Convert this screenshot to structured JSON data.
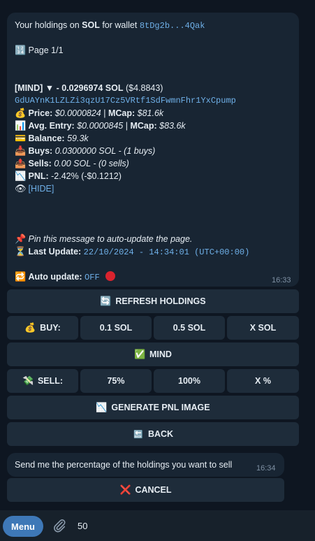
{
  "message": {
    "intro_prefix": "Your holdings on ",
    "intro_chain": "SOL",
    "intro_mid": " for wallet ",
    "intro_wallet": "8tDg2b...4Qak",
    "page_icon": "🔢",
    "page_label": "Page 1/1",
    "token_header_name": "[MIND] ▼ - 0.0296974 SOL",
    "token_header_usd": " ($4.8843)",
    "token_address": "GdUAYnK1LZLZi3qzU17Cz5VRtf1SdFwmnFhr1YxCpump",
    "price": {
      "icon": "💰",
      "label": "Price:",
      "value": "$0.0000824",
      "sep": " | ",
      "mcap_label": "MCap:",
      "mcap_value": "$81.6k"
    },
    "avg_entry": {
      "icon": "📊",
      "label": "Avg. Entry:",
      "value": "$0.0000845",
      "sep": " | ",
      "mcap_label": "MCap:",
      "mcap_value": "$83.6k"
    },
    "balance": {
      "icon": "💳",
      "label": "Balance:",
      "value": "59.3k"
    },
    "buys": {
      "icon": "📥",
      "label": "Buys:",
      "value": "0.0300000 SOL - (1 buys)"
    },
    "sells": {
      "icon": "📤",
      "label": "Sells:",
      "value": "0.00 SOL - (0 sells)"
    },
    "pnl": {
      "icon": "📉",
      "label": "PNL:",
      "value": "-2.42% (-$0.1212)"
    },
    "hide": {
      "icon": "👁",
      "label": "[HIDE]"
    },
    "pin": {
      "icon": "📌",
      "text": "Pin this message to auto-update the page."
    },
    "last_update": {
      "icon": "⏳",
      "label": "Last Update:",
      "value": "22/10/2024 - 14:34:01 (UTC+00:00)"
    },
    "auto_update": {
      "icon": "🔁",
      "label": "Auto update:",
      "value": "OFF"
    },
    "time": "16:33"
  },
  "buttons": {
    "refresh": {
      "icon": "🔄",
      "label": "REFRESH HOLDINGS"
    },
    "buy_label": {
      "icon": "💰",
      "label": "BUY:"
    },
    "buy_1": "0.1 SOL",
    "buy_2": "0.5 SOL",
    "buy_3": "X SOL",
    "token": {
      "icon": "✅",
      "label": "MIND"
    },
    "sell_label": {
      "icon": "💸",
      "label": "SELL:"
    },
    "sell_1": "75%",
    "sell_2": "100%",
    "sell_3": "X %",
    "pnl_image": {
      "icon": "📉",
      "label": "GENERATE PNL IMAGE"
    },
    "back": {
      "icon": "🔙",
      "label": "BACK"
    }
  },
  "reply": {
    "text": "Send me the percentage of the holdings you want to sell",
    "time": "16:34",
    "cancel": {
      "icon": "❌",
      "label": "CANCEL"
    }
  },
  "input_bar": {
    "menu_label": "Menu",
    "value": "50"
  }
}
